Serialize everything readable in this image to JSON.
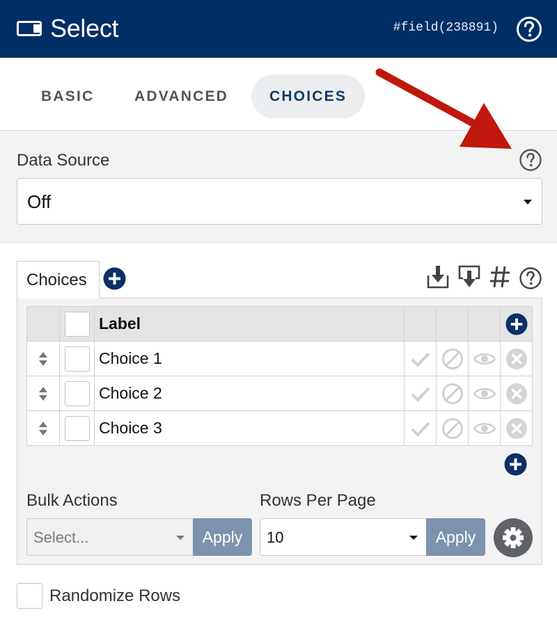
{
  "header": {
    "title": "Select",
    "field_id": "#field(238891)",
    "icon": "select-field-icon",
    "help_icon": "help-circle-icon",
    "background": "#002e66"
  },
  "tabs": [
    {
      "label": "BASIC",
      "active": false
    },
    {
      "label": "ADVANCED",
      "active": false
    },
    {
      "label": "CHOICES",
      "active": true
    }
  ],
  "data_source": {
    "label": "Data Source",
    "value": "Off",
    "help_icon": "help-circle-icon"
  },
  "annotation": {
    "type": "arrow",
    "color": "#c0180c",
    "points_to": "data-source-help-icon"
  },
  "choices": {
    "tab_label": "Choices",
    "tools": [
      "import-icon",
      "export-icon",
      "hash-icon",
      "help-circle-icon"
    ],
    "columns": {
      "label": "Label"
    },
    "rows": [
      {
        "label": "Choice 1"
      },
      {
        "label": "Choice 2"
      },
      {
        "label": "Choice 3"
      }
    ],
    "row_icons": [
      "check-icon",
      "disabled-icon",
      "eye-icon",
      "remove-icon"
    ]
  },
  "bulk_actions": {
    "label": "Bulk Actions",
    "placeholder": "Select...",
    "apply_label": "Apply"
  },
  "rows_per_page": {
    "label": "Rows Per Page",
    "value": "10",
    "apply_label": "Apply"
  },
  "randomize": {
    "label": "Randomize Rows",
    "checked": false
  },
  "colors": {
    "primary": "#002e66",
    "apply_button": "#7d93ad",
    "gear_button": "#5f6266",
    "panel_bg": "#f3f3f3"
  }
}
